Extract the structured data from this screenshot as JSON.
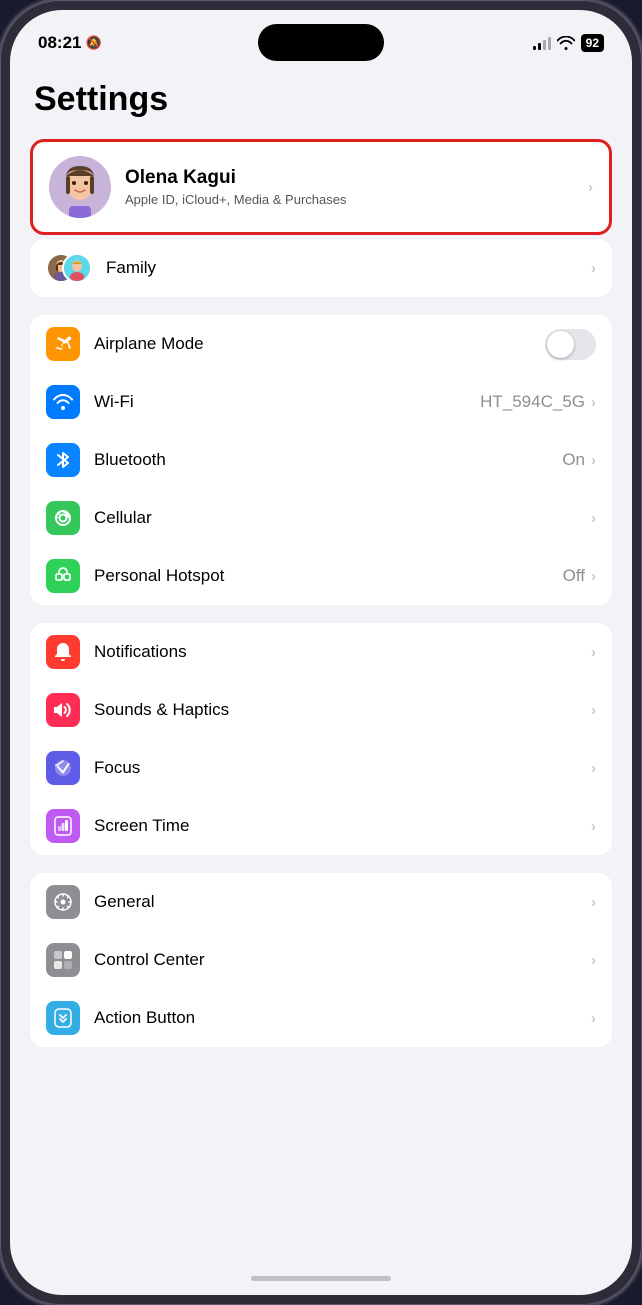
{
  "statusBar": {
    "time": "08:21",
    "battery": "92",
    "muted": true
  },
  "page": {
    "title": "Settings"
  },
  "profile": {
    "name": "Olena Kagui",
    "subtitle": "Apple ID, iCloud+, Media & Purchases",
    "avatarEmoji": "👩"
  },
  "profileGroup": {
    "rows": [
      {
        "label": "Family",
        "value": "",
        "hasChevron": true
      }
    ]
  },
  "connectivityGroup": {
    "rows": [
      {
        "id": "airplane",
        "label": "Airplane Mode",
        "iconColor": "orange",
        "hasToggle": true,
        "toggleOn": false
      },
      {
        "id": "wifi",
        "label": "Wi-Fi",
        "iconColor": "blue",
        "value": "HT_594C_5G",
        "hasChevron": true
      },
      {
        "id": "bluetooth",
        "label": "Bluetooth",
        "iconColor": "blue2",
        "value": "On",
        "hasChevron": true
      },
      {
        "id": "cellular",
        "label": "Cellular",
        "iconColor": "green",
        "hasChevron": true
      },
      {
        "id": "hotspot",
        "label": "Personal Hotspot",
        "iconColor": "green2",
        "value": "Off",
        "hasChevron": true
      }
    ]
  },
  "notificationsGroup": {
    "rows": [
      {
        "id": "notifications",
        "label": "Notifications",
        "iconColor": "red",
        "hasChevron": true
      },
      {
        "id": "sounds",
        "label": "Sounds & Haptics",
        "iconColor": "pink",
        "hasChevron": true
      },
      {
        "id": "focus",
        "label": "Focus",
        "iconColor": "indigo",
        "hasChevron": true
      },
      {
        "id": "screentime",
        "label": "Screen Time",
        "iconColor": "purple2",
        "hasChevron": true
      }
    ]
  },
  "generalGroup": {
    "rows": [
      {
        "id": "general",
        "label": "General",
        "iconColor": "gray",
        "hasChevron": true
      },
      {
        "id": "controlcenter",
        "label": "Control Center",
        "iconColor": "gray",
        "hasChevron": true
      },
      {
        "id": "actionbutton",
        "label": "Action Button",
        "iconColor": "teal",
        "hasChevron": true
      }
    ]
  }
}
